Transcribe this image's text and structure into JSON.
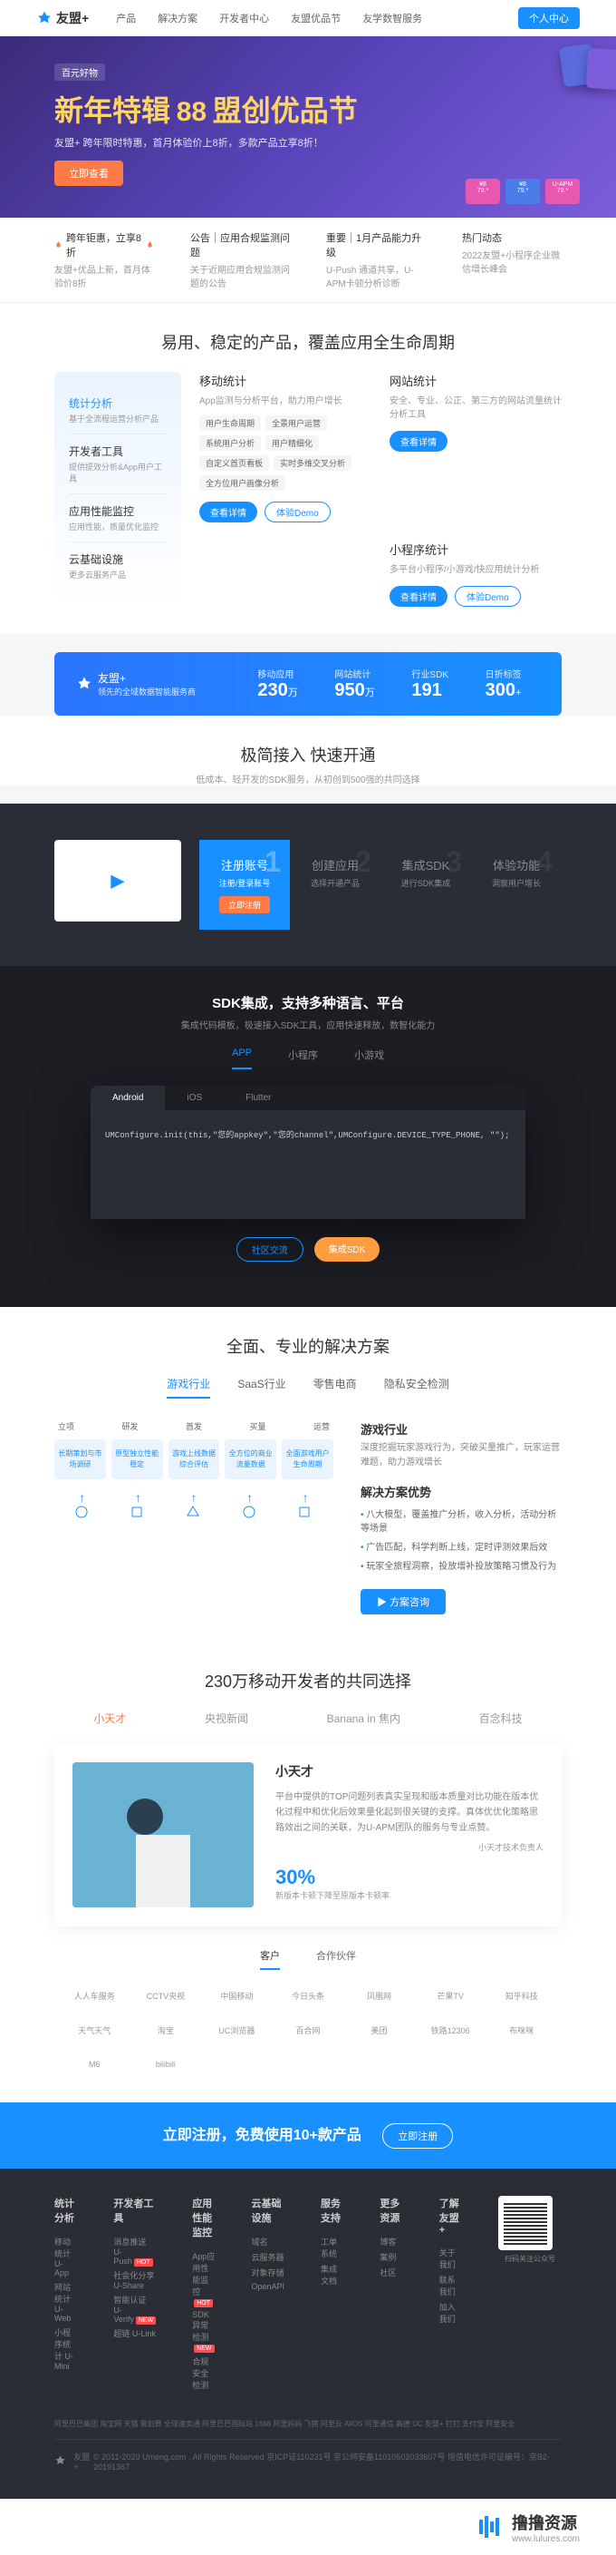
{
  "header": {
    "logo": "友盟+",
    "nav": [
      "产品",
      "解决方案",
      "开发者中心",
      "友盟优品节",
      "友学数智服务"
    ],
    "userCenter": "个人中心"
  },
  "hero": {
    "badge": "百元好物",
    "titlePre": "新年特辑",
    "titleNum": "88",
    "titlePost": "盟创优品节",
    "sub": "友盟+ 跨年限时特惠，首月体验价上8折，多款产品立享8折！",
    "btn": "立即查看"
  },
  "notices": [
    {
      "tit": "跨年钜惠，立享8折",
      "sub": "友盟+优品上新，首月体验价8折",
      "icon": "fire"
    },
    {
      "tit": "公告｜应用合规监测问题",
      "sub": "关于近期应用合规监测问题的公告",
      "icon": ""
    },
    {
      "tit": "重要｜1月产品能力升级",
      "sub": "U-Push 通道共享，U-APM卡顿分析诊断",
      "icon": ""
    },
    {
      "tit": "热门动态",
      "sub": "2022友盟+小程序企业微信增长峰会",
      "icon": ""
    }
  ],
  "sec1": {
    "title": "易用、稳定的产品，覆盖应用全生命周期",
    "sidebar": [
      {
        "t": "统计分析",
        "s": "基于全流程运营分析产品",
        "active": true
      },
      {
        "t": "开发者工具",
        "s": "提供提效分析&App用户工具"
      },
      {
        "t": "应用性能监控",
        "s": "应用性能，质量优化监控"
      },
      {
        "t": "云基础设施",
        "s": "更多云服务产品"
      }
    ],
    "cards": [
      {
        "t": "移动统计",
        "s": "App监测与分析平台，助力用户增长",
        "tags": [
          "用户生命周期",
          "全景用户运营",
          "系统用户分析",
          "用户精细化",
          "自定义首页看板",
          "实时多维交叉分析",
          "全方位用户画像分析"
        ],
        "btns": [
          "查看详情",
          "体验Demo"
        ]
      },
      {
        "t": "网站统计",
        "s": "安全、专业、公正、第三方的网站流量统计分析工具",
        "tags": [],
        "btns": [
          "查看详情"
        ]
      },
      {
        "t": "",
        "s": "",
        "hide": true
      },
      {
        "t": "小程序统计",
        "s": "多平台小程序/小游戏/快应用统计分析",
        "tags": [],
        "btns": [
          "查看详情",
          "体验Demo"
        ]
      }
    ]
  },
  "stats": {
    "logo": "友盟+",
    "sub": "领先的全域数据智能服务商",
    "items": [
      {
        "l": "移动应用",
        "n": "230",
        "u": "万"
      },
      {
        "l": "网站统计",
        "n": "950",
        "u": "万"
      },
      {
        "l": "行业SDK",
        "n": "191",
        "u": ""
      },
      {
        "l": "日折标签",
        "n": "300",
        "u": "+"
      }
    ]
  },
  "sec2": {
    "title": "极简接入 快速开通",
    "sub": "低成本、轻开发的SDK服务，从初创到500强的共同选择",
    "steps": [
      {
        "n": "1",
        "t": "注册账号",
        "s": "注册/登录账号",
        "btn": "立即注册",
        "active": true
      },
      {
        "n": "2",
        "t": "创建应用",
        "s": "选择开通产品"
      },
      {
        "n": "3",
        "t": "集成SDK",
        "s": "进行SDK集成"
      },
      {
        "n": "4",
        "t": "体验功能",
        "s": "洞察用户增长"
      }
    ]
  },
  "sdk": {
    "title": "SDK集成，支持多种语言、平台",
    "sub": "集成代码模板，极速接入SDK工具，应用快速释放，数智化能力",
    "tabs": [
      "APP",
      "小程序",
      "小游戏"
    ],
    "codeTabs": [
      "Android",
      "iOS",
      "Flutter"
    ],
    "code": "UMConfigure.init(this,\"您的appkey\",\"您的channel\",UMConfigure.DEVICE_TYPE_PHONE, \"\");",
    "btn1": "社区交流",
    "btn2": "集成SDK"
  },
  "solution": {
    "title": "全面、专业的解决方案",
    "tabs": [
      "游戏行业",
      "SaaS行业",
      "零售电商",
      "隐私安全检测"
    ],
    "flowLabels": [
      "立项",
      "研发",
      "首发",
      "买量",
      "运营"
    ],
    "flowBoxes": [
      "长期策划与市场调研",
      "原型独立性能稳定",
      "游戏上线数据综合评估",
      "全方位的商业流量数据",
      "全面游戏用户生命周期"
    ],
    "h1": "游戏行业",
    "p1": "深度挖掘玩家游戏行为，突破买量推广，玩家运营难题，助力游戏增长",
    "h2": "解决方案优势",
    "items": [
      "八大模型，覆盖推广分析，收入分析，活动分析等场景",
      "广告匹配，科学判断上线，定时评测效果后效",
      "玩家全旅程洞察，投放增补投放策略习惯及行为"
    ],
    "cta": "方案咨询"
  },
  "customers": {
    "title": "230万移动开发者的共同选择",
    "logos": [
      "小天才",
      "央视新闻",
      "Banana in 焦内",
      "百念科技"
    ],
    "activeLogoIdx": 0,
    "card": {
      "name": "小天才",
      "desc": "平台中提供的TOP问题列表真实呈现和版本质量对比功能在版本优化过程中和优化后效果量化起到很关键的支撑。真体优优化策略思路效出之间的关联，为U-APM团队的服务与专业点赞。",
      "author": "小天才技术负责人",
      "stat": "30%",
      "statDesc": "新版本卡顿下降至原版本卡顿率"
    },
    "partnerTabs": [
      "客户",
      "合作伙伴"
    ],
    "logoGrid": [
      "人人车服务",
      "CCTV央视",
      "中国移动",
      "今日头条",
      "凤凰网",
      "芒果TV",
      "知乎科技",
      "天气天气",
      "淘宝",
      "UC浏览器",
      "百合网",
      "美团",
      "铁路12306",
      "布咪咪",
      "M6",
      "bilibili"
    ]
  },
  "ctaBanner": {
    "text": "立即注册，免费使用10+款产品",
    "btn": "立即注册"
  },
  "footer": {
    "cols": [
      {
        "t": "统计分析",
        "links": [
          "移动统计 U-App",
          "网站统计 U-Web",
          "小程序统计 U-Mini"
        ]
      },
      {
        "t": "开发者工具",
        "links": [
          "消息推送 U-Push",
          "社会化分享 U-Share",
          "智能认证 U-Verify",
          "超链 U-Link"
        ]
      },
      {
        "t": "应用性能监控",
        "links": [
          "App应用性能监控",
          "SDK异常检测",
          "合规安全检测"
        ]
      },
      {
        "t": "云基础设施",
        "links": [
          "域名",
          "云服务器",
          "对象存储",
          "OpenAPI"
        ]
      },
      {
        "t": "服务支持",
        "links": [
          "工单系统",
          "集成文档"
        ]
      },
      {
        "t": "更多资源",
        "links": [
          "博客",
          "案例",
          "社区"
        ]
      },
      {
        "t": "了解友盟+",
        "links": [
          "关于我们",
          "联系我们",
          "加入我们"
        ]
      }
    ],
    "qrLabel": "扫码关注公众号",
    "bottomLinks": "阿里巴巴集团 淘宝网 天猫 聚划算 全球速卖通 阿里巴巴国际站 1688 阿里妈妈 飞猪 阿里云 AliOS 阿里通信 高德 UC 友盟+ 钉钉 支付宝 阿里安全",
    "copyright": "© 2011-2020 Umeng.com , All Rights Reserved 京ICP证110231号 京公网安备11010502033607号 增值电信许可证编号：京B2-20191367"
  },
  "watermark": {
    "main": "撸撸资源",
    "sub": "www.lulures.com"
  }
}
